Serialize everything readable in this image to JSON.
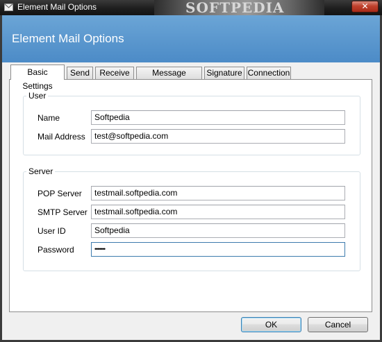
{
  "window": {
    "title": "Element Mail Options",
    "close_glyph": "✕",
    "watermark_text": "SOFTPEDIA"
  },
  "header": {
    "title": "Element Mail Options"
  },
  "tabs": [
    {
      "label": "Basic Settings",
      "active": true
    },
    {
      "label": "Send"
    },
    {
      "label": "Receive"
    },
    {
      "label": "Message Creation"
    },
    {
      "label": "Signature"
    },
    {
      "label": "Connection"
    }
  ],
  "user_group": {
    "legend": "User",
    "name_label": "Name",
    "name_value": "Softpedia",
    "mail_label": "Mail Address",
    "mail_value": "test@softpedia.com"
  },
  "server_group": {
    "legend": "Server",
    "pop_label": "POP Server",
    "pop_value": "testmail.softpedia.com",
    "smtp_label": "SMTP Server",
    "smtp_value": "testmail.softpedia.com",
    "userid_label": "User ID",
    "userid_value": "Softpedia",
    "password_label": "Password",
    "password_value": "•••••••"
  },
  "buttons": {
    "ok": "OK",
    "cancel": "Cancel"
  },
  "colors": {
    "header": "#4c8bc7",
    "close": "#c0412d",
    "titlebar": "#1e1e1e"
  }
}
